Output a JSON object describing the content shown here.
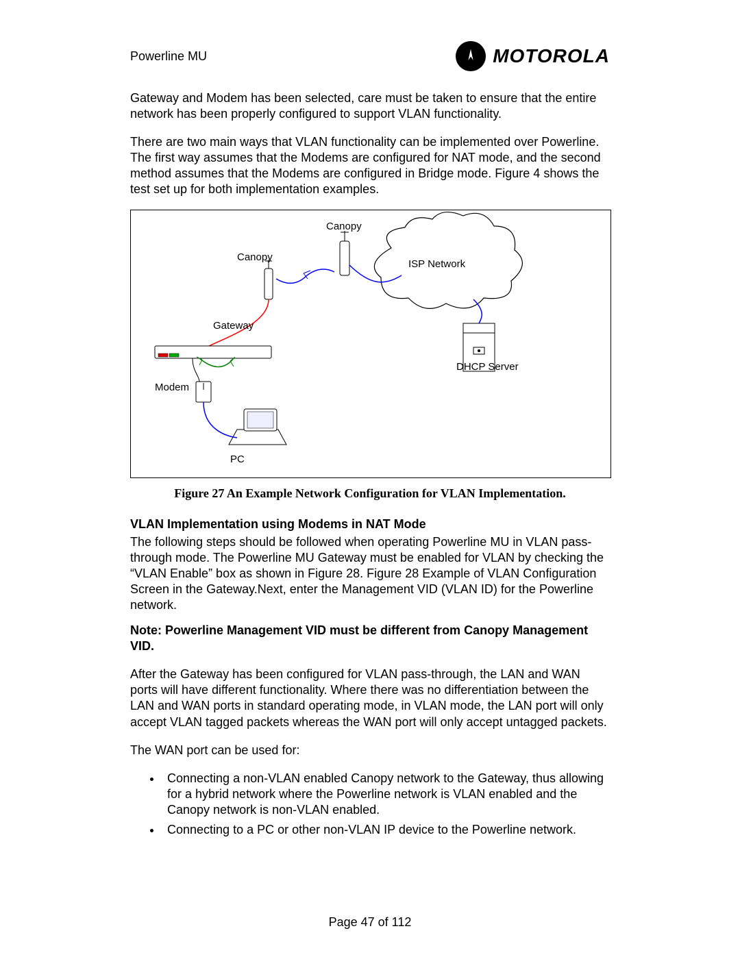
{
  "header": {
    "doc_title": "Powerline MU",
    "brand": "MOTOROLA"
  },
  "para1": "Gateway and Modem has been selected, care must be taken to ensure that the entire network has been properly configured to support VLAN functionality.",
  "para2": "There are two main ways that VLAN functionality can be implemented over Powerline.  The first way assumes that the Modems are configured for NAT mode, and the second method assumes that the Modems are configured in Bridge mode.  Figure 4 shows the test set up for both implementation examples.",
  "figure": {
    "caption": "Figure 27 An Example Network Configuration for VLAN Implementation.",
    "labels": {
      "canopy1": "Canopy",
      "canopy2": "Canopy",
      "isp": "ISP Network",
      "gateway": "Gateway",
      "dhcp": "DHCP Server",
      "modem": "Modem",
      "pc": "PC"
    }
  },
  "section_heading": "VLAN Implementation using Modems in NAT Mode",
  "para3": "The following steps should be followed when operating Powerline MU in VLAN pass-through mode.  The Powerline MU Gateway must be enabled for VLAN by checking the “VLAN Enable” box as shown in Figure 28. Figure 28  Example of VLAN Configuration Screen in the Gateway.Next, enter the Management VID (VLAN ID) for the Powerline network.",
  "note": "Note:  Powerline Management VID must be different from Canopy Management VID.",
  "para4": "After the Gateway has been configured for VLAN pass-through, the LAN and WAN ports will have different functionality.  Where there was no differentiation between the LAN and WAN ports in standard operating mode, in VLAN mode, the LAN port will only accept VLAN tagged packets whereas the WAN port will only accept untagged packets.",
  "para5": "The WAN port can be used for:",
  "bullets": [
    "Connecting a non-VLAN enabled Canopy network to the Gateway, thus allowing for a hybrid network where the Powerline network is VLAN enabled and the Canopy network is non-VLAN enabled.",
    "Connecting to a PC or other non-VLAN IP device to the Powerline network."
  ],
  "footer": {
    "page_number": "Page 47 of 112"
  }
}
